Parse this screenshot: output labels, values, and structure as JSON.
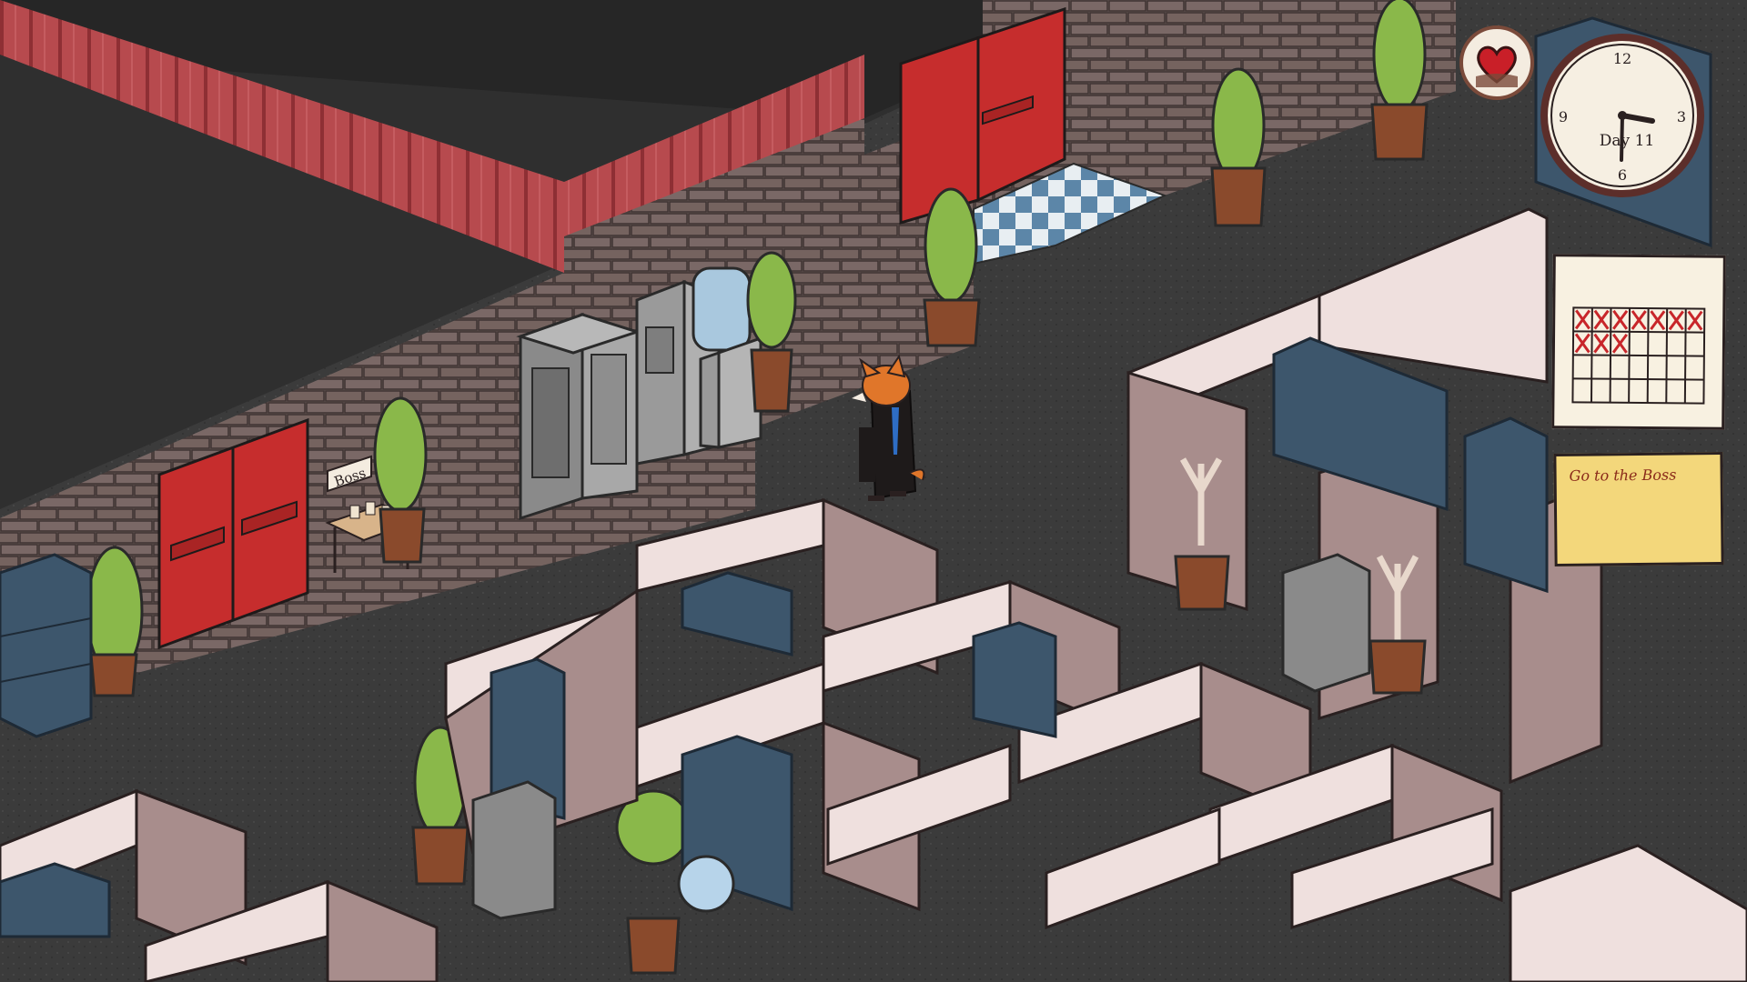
{
  "hud": {
    "day_label": "Day 11",
    "clock_numerals": [
      "12",
      "3",
      "6",
      "9"
    ],
    "task_note": "Go to the Boss",
    "calendar_days_crossed": 10,
    "heart_icon": "heart-icon"
  },
  "world": {
    "boss_sign": "Boss"
  },
  "colors": {
    "floor": "#3a3a3a",
    "roof": "#2f2f2f",
    "brick": "#6c5c5a",
    "door_red": "#c62d2d",
    "cubicle_light": "#efe0de",
    "cubicle_dark": "#a88d8c",
    "locker_blue": "#3d566c",
    "note_yellow": "#f3d77b"
  }
}
